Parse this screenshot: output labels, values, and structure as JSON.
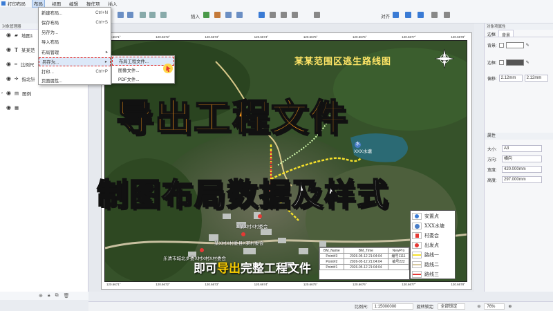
{
  "window": {
    "title": "打印布局"
  },
  "menubar": [
    "布局",
    "视图",
    "编辑",
    "操作项",
    "插入"
  ],
  "toolbar": {
    "insert_label": "插入",
    "align_label": "对齐"
  },
  "file_menu": {
    "items": [
      {
        "label": "新建布局...",
        "shortcut": "Ctrl+N"
      },
      {
        "label": "保存布局",
        "shortcut": "Ctrl+S"
      },
      {
        "label": "另存为...",
        "shortcut": ""
      },
      {
        "label": "导入布局",
        "shortcut": ""
      },
      {
        "label": "布局管理",
        "shortcut": "▸"
      },
      {
        "label": "另存为...",
        "shortcut": "▸"
      },
      {
        "label": "打印...",
        "shortcut": "Ctrl+P"
      },
      {
        "label": "页面属性...",
        "shortcut": ""
      }
    ]
  },
  "submenu": {
    "items": [
      "布局工程文件...",
      "图像文件...",
      "PDF文件..."
    ]
  },
  "left_panel": {
    "title": "对象管理器",
    "layers": [
      {
        "icon": "folder-icon",
        "label": "地图1"
      },
      {
        "icon": "text-icon",
        "label": "某某范"
      },
      {
        "icon": "scalebar-icon",
        "label": "比例尺"
      },
      {
        "icon": "compass-icon",
        "label": "指北针"
      },
      {
        "icon": "legend-icon",
        "label": "图例"
      }
    ]
  },
  "map": {
    "title": "某某范围区逃生路线图",
    "lake_label": "XXX水塘",
    "lake_icon_text": "水",
    "village_labels": [
      "X某X村X村委会",
      "某X村X村委县X某村委会",
      "乐清市城北乡委X村X村X村委会"
    ],
    "top_scale": [
      "120.6671°",
      "120.6672°",
      "120.6673°",
      "120.6674°",
      "120.6675°",
      "120.6676°",
      "120.6677°",
      "120.6678°"
    ],
    "bottom_scale": [
      "120.6671°",
      "120.6672°",
      "120.6673°",
      "120.6674°",
      "120.6675°",
      "120.6676°",
      "120.6677°",
      "120.6678°"
    ]
  },
  "overlay": {
    "big1": "导出工程文件",
    "big2": "制图布局数据及样式",
    "subtitle_pre": "即可",
    "subtitle_hl": "导出",
    "subtitle_post": "完整工程文件"
  },
  "attr_table": {
    "headers": [
      "BM_Name",
      "BM_Time",
      "NewPro"
    ],
    "rows": [
      [
        "Point#3",
        "2026-05-12 21:04:04",
        "编号1111"
      ],
      [
        "Point#2",
        "2026-05-12 21:04:04",
        "编号222"
      ],
      [
        "Point#1",
        "2026-05-12 21:04:04",
        ""
      ]
    ]
  },
  "legend": {
    "items": [
      {
        "symbol": "safe-point",
        "label": "安置点"
      },
      {
        "symbol": "lake",
        "label": "XXX水塘"
      },
      {
        "symbol": "village",
        "label": "村委会"
      },
      {
        "symbol": "start",
        "label": "出发点"
      },
      {
        "symbol": "route1",
        "label": "路线一"
      },
      {
        "symbol": "route2",
        "label": "路线二"
      },
      {
        "symbol": "route3",
        "label": "路线三"
      }
    ]
  },
  "right_panel": {
    "title": "对象项属性",
    "tabs": [
      "边框",
      "背景"
    ],
    "bg_label": "背景:",
    "border_label": "边框:",
    "offset_label": "偏移:",
    "offset_x": "2.12mm",
    "offset_y": "2.12mm",
    "section": "属性",
    "size_label": "大小:",
    "size_value": "A3",
    "orient_label": "方向:",
    "orient_value": "横向",
    "width_label": "宽度:",
    "width_value": "420.000mm",
    "height_label": "高度:",
    "height_value": "297.000mm"
  },
  "status": {
    "scale_label": "比例尺:",
    "scale_value": "1:15000000",
    "lock_label": "旋转锁定:",
    "lock_value": "全部锁定",
    "zoom": "76%"
  },
  "colors": {
    "accent": "#ff9a1a",
    "route_red": "#e53935",
    "route_yellow": "#f5e02a"
  }
}
